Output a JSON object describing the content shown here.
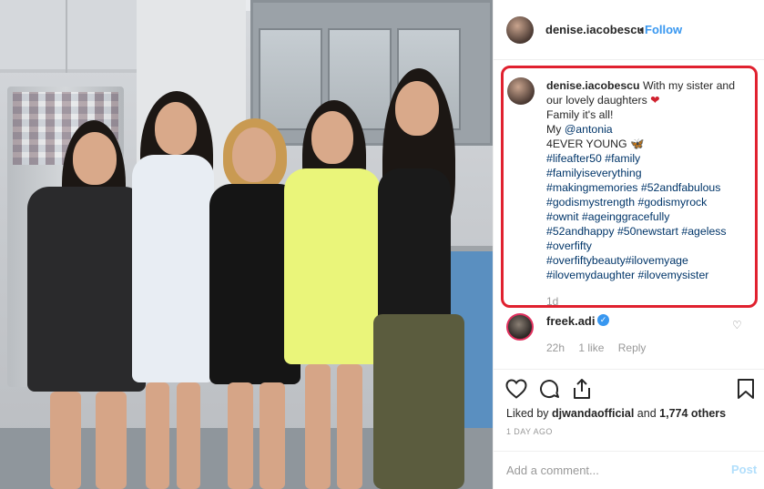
{
  "post": {
    "username": "denise.iacobescu",
    "separator": "•",
    "follow_label": "Follow"
  },
  "caption": {
    "username": "denise.iacobescu",
    "line1": "With my sister and",
    "line2": "our lovely daughters",
    "line2_emoji": "❤",
    "line3": "Family it's all!",
    "line4_prefix": "My ",
    "line4_mention": "@antonia",
    "line5": "4EVER YOUNG",
    "line5_emoji": "🦋",
    "hashtag_lines": [
      "#lifeafter50 #family",
      "#familyiseverything",
      "#makingmemories #52andfabulous",
      "#godismystrength #godismyrock",
      "#ownit #ageinggracefully",
      "#52andhappy #50newstart #ageless",
      "#overfifty",
      "#overfiftybeauty#ilovemyage",
      "#ilovemydaughter #ilovemysister"
    ],
    "time": "1d"
  },
  "comment": {
    "username": "freek.adi",
    "verified_mark": "✓",
    "time": "22h",
    "likes": "1 like",
    "reply_label": "Reply"
  },
  "likes": {
    "prefix": "Liked by ",
    "user": "djwandaofficial",
    "middle": " and ",
    "count": "1,774 others"
  },
  "date": "1 DAY AGO",
  "add_comment": {
    "placeholder": "Add a comment...",
    "post_label": "Post"
  },
  "colors": {
    "link": "#3897f0",
    "hashtag": "#003569",
    "highlight_border": "#e0212f"
  },
  "icons": [
    "heart-icon",
    "comment-icon",
    "share-icon",
    "bookmark-icon"
  ]
}
